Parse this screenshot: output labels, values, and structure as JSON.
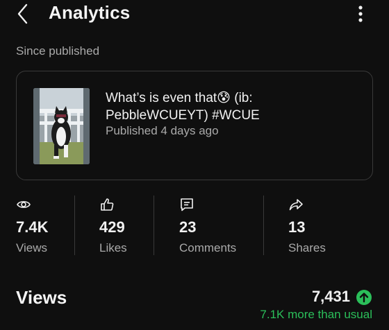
{
  "header": {
    "title": "Analytics",
    "back_icon": "chevron-left-icon",
    "more_icon": "more-vert-icon"
  },
  "section_label": "Since published",
  "video": {
    "title": "What’s is even that😰 (ib: PebbleWCUEYT) #WCUE",
    "published": "Published 4 days ago"
  },
  "stats": [
    {
      "icon": "eye-icon",
      "value": "7.4K",
      "label": "Views"
    },
    {
      "icon": "thumbs-up-icon",
      "value": "429",
      "label": "Likes"
    },
    {
      "icon": "comment-icon",
      "value": "23",
      "label": "Comments"
    },
    {
      "icon": "share-icon",
      "value": "13",
      "label": "Shares"
    }
  ],
  "views_section": {
    "heading": "Views",
    "total": "7,431",
    "delta": "7.1K more than usual",
    "delta_color": "#2bbf5a"
  }
}
